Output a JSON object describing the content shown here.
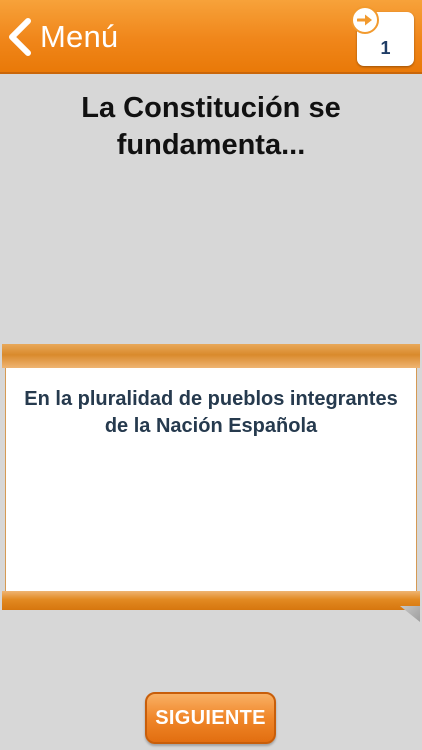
{
  "header": {
    "back_label": "Menú",
    "counter_value": "1"
  },
  "question": {
    "text": "La Constitución se fundamenta..."
  },
  "answer": {
    "text": "En la pluralidad de pueblos integrantes de la Nación Española"
  },
  "actions": {
    "next_label": "SIGUIENTE"
  },
  "icons": {
    "back": "chevron-left-icon",
    "counter": "arrow-right-icon"
  },
  "colors": {
    "accent": "#f0861a",
    "background": "#d7d7d7",
    "answer_text": "#263a4e",
    "counter_text": "#1f3d66"
  }
}
